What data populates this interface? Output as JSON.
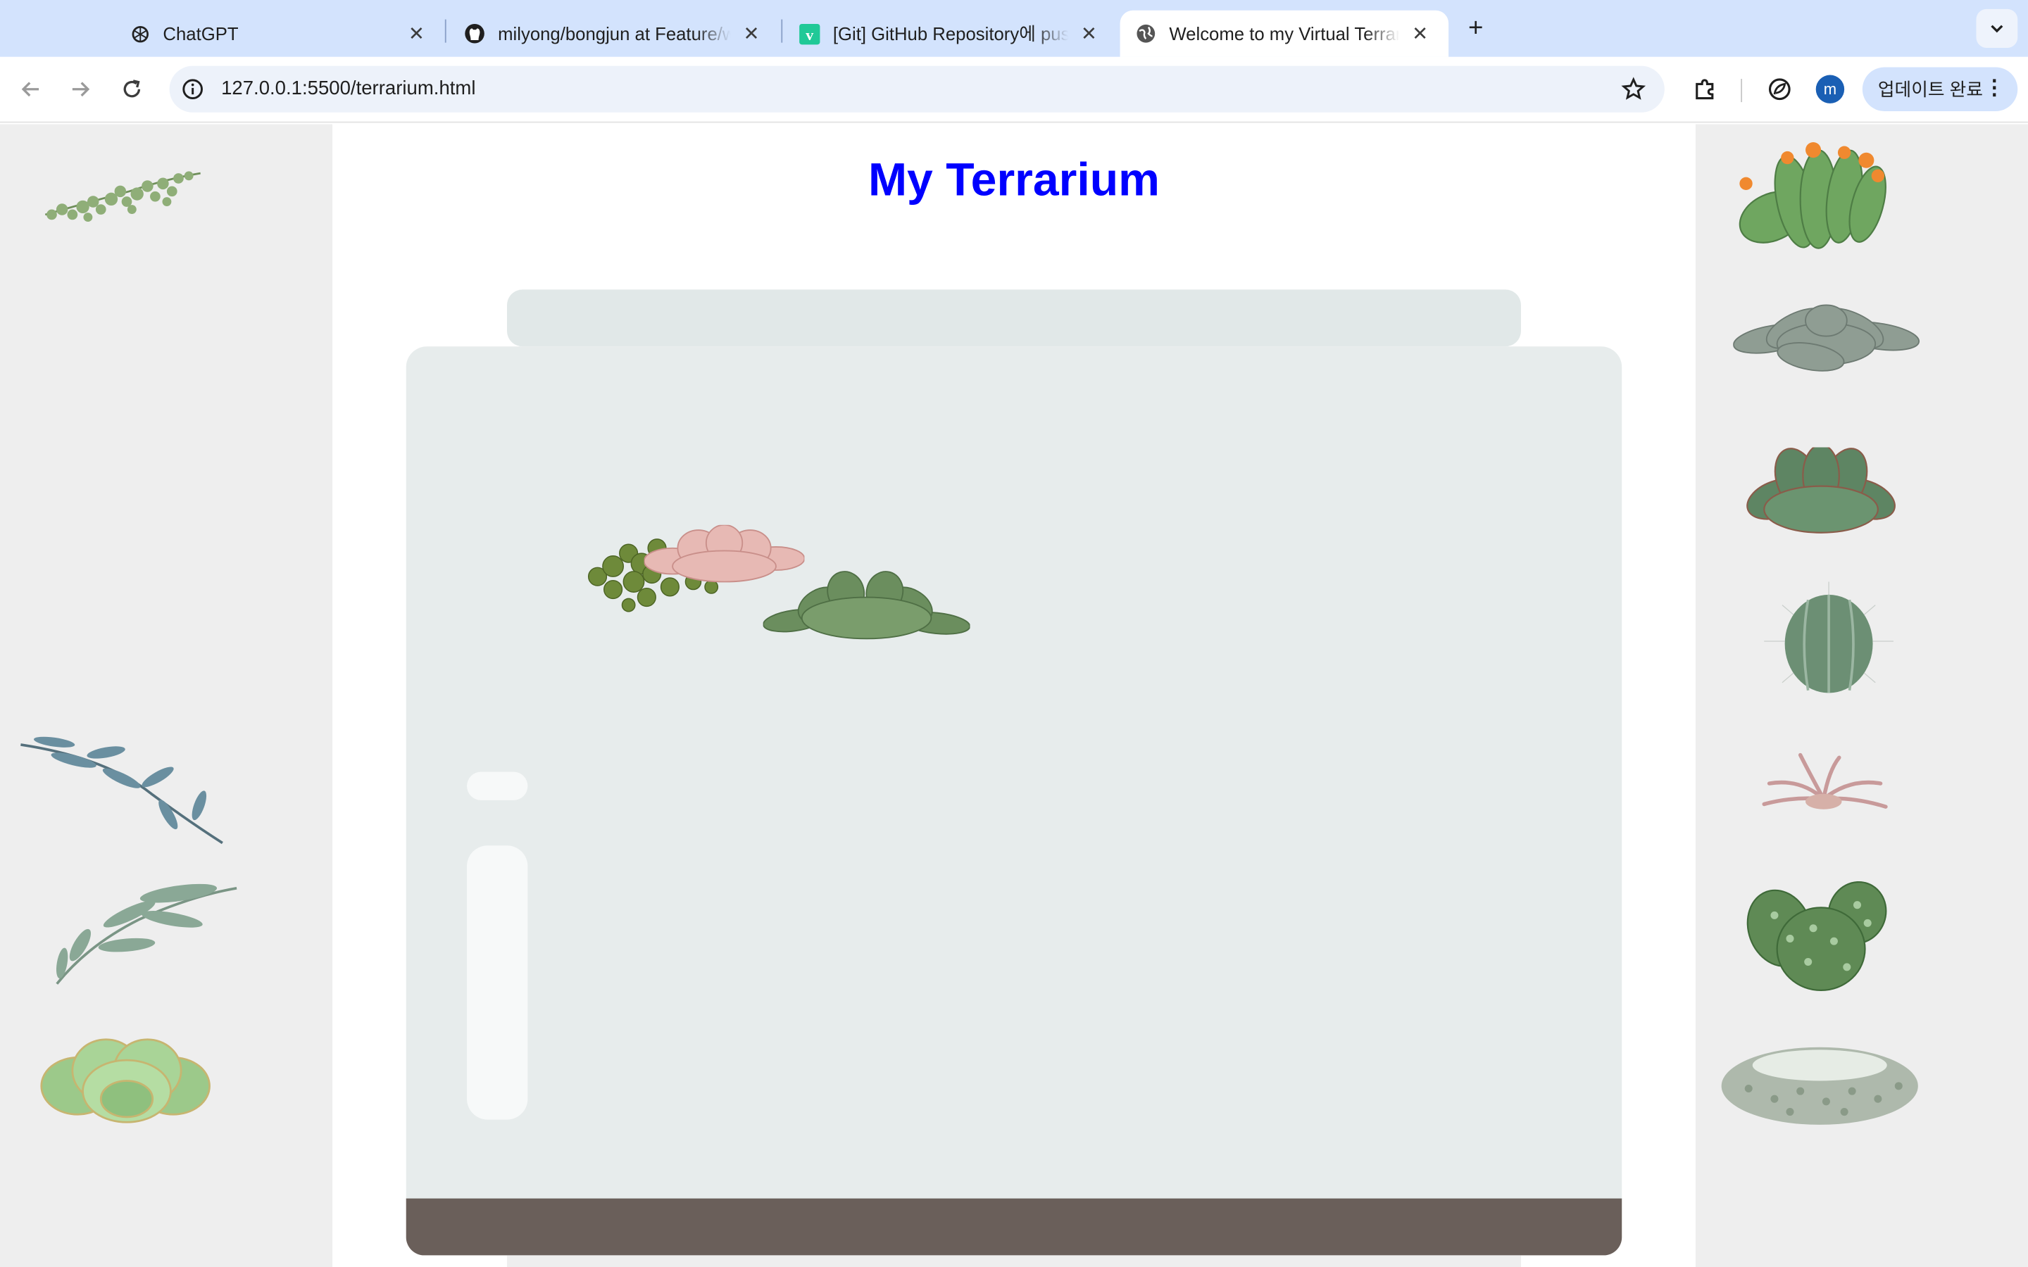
{
  "browser": {
    "tabs": [
      {
        "title": "ChatGPT",
        "icon": "chatgpt-icon"
      },
      {
        "title": "milyong/bongjun at Feature/w",
        "icon": "github-icon"
      },
      {
        "title": "[Git] GitHub Repository에 pus",
        "icon": "velog-icon"
      },
      {
        "title": "Welcome to my Virtual Terrari",
        "icon": "globe-icon",
        "active": true
      }
    ],
    "url": "127.0.0.1:5500/terrarium.html",
    "avatar_letter": "m",
    "update_label": "업데이트 완료"
  },
  "page": {
    "title": "My Terrarium",
    "title_color": "#0000ff",
    "soil_color": "#6a5f5a",
    "jar_color": "#e7ecec"
  },
  "plants": {
    "left": [
      "trailing-pearls-plant",
      "eucalyptus-sprig-plant",
      "olive-branch-plant",
      "rosette-succulent-plant"
    ],
    "right": [
      "flowering-cactus-plant",
      "silver-echeveria-plant",
      "green-aloe-plant",
      "round-cactus-plant",
      "air-plant",
      "prickly-pear-plant",
      "spiky-mound-plant"
    ],
    "in_jar": [
      "crassula-plant",
      "pink-echeveria-plant",
      "green-echeveria-plant"
    ]
  }
}
